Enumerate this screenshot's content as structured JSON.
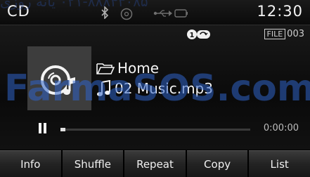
{
  "status": {
    "source": "CD",
    "clock": "12:30"
  },
  "watermark": {
    "top": "۰۲۱-۸۸۸۴۳۰۸۵ یانه روزی",
    "mid": "FarmaSOS.com"
  },
  "file": {
    "tag": "FILE",
    "number": "003"
  },
  "folder": {
    "name": "Home"
  },
  "track": {
    "name": "02 Music.mp3"
  },
  "playback": {
    "state": "paused",
    "elapsed": "0:00:00",
    "progress_percent": 0
  },
  "buttons": [
    "Info",
    "Shuffle",
    "Repeat",
    "Copy",
    "List"
  ],
  "icons": {
    "status": [
      "bluetooth-icon",
      "disc-icon",
      "usb-icon",
      "ipod-icon"
    ],
    "mode": "repeat-one-icon",
    "folder": "folder-icon",
    "track": "music-note-icon",
    "album": "cd-music-icon"
  },
  "colors": {
    "background": "#0a0a0a",
    "text": "#f4f4f4",
    "album_bg": "#3d3d3d",
    "watermark": "#2f63c8"
  }
}
